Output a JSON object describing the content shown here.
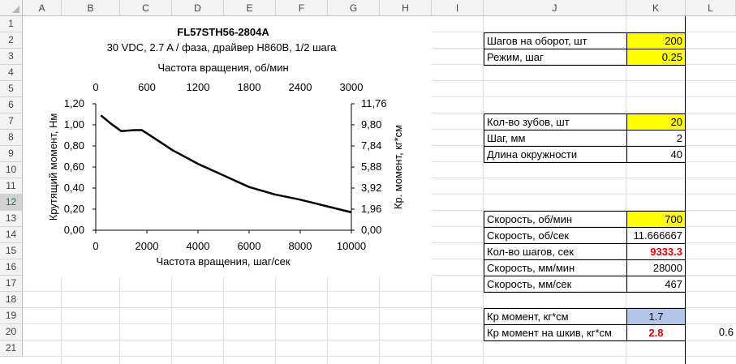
{
  "columns": [
    "A",
    "B",
    "C",
    "D",
    "E",
    "F",
    "G",
    "H",
    "I",
    "J",
    "K",
    "L"
  ],
  "rows": [
    "1",
    "2",
    "3",
    "4",
    "5",
    "6",
    "7",
    "8",
    "9",
    "10",
    "11",
    "12",
    "13",
    "14",
    "15",
    "16",
    "17",
    "18",
    "19",
    "20",
    "21"
  ],
  "selected_row": "12",
  "params": [
    {
      "row": 2,
      "label": "Шагов на оборот, шт",
      "value": "200",
      "fill": "yellow"
    },
    {
      "row": 3,
      "label": "Режим, шаг",
      "value": "0.25",
      "fill": "yellow"
    },
    {
      "row": 7,
      "label": "Кол-во зубов, шт",
      "value": "20",
      "fill": "yellow"
    },
    {
      "row": 8,
      "label": "Шаг, мм",
      "value": "2",
      "fill": ""
    },
    {
      "row": 9,
      "label": "Длина окружности",
      "value": "40",
      "fill": ""
    },
    {
      "row": 13,
      "label": "Скорость, об/мин",
      "value": "700",
      "fill": "yellow"
    },
    {
      "row": 14,
      "label": "Скорость, об/сек",
      "value": "11.666667",
      "fill": ""
    },
    {
      "row": 15,
      "label": "Кол-во шагов, сек",
      "value": "9333.3",
      "fill": "",
      "style": "red-right"
    },
    {
      "row": 16,
      "label": "Скорость, мм/мин",
      "value": "28000",
      "fill": ""
    },
    {
      "row": 17,
      "label": "Скорость, мм/сек",
      "value": "467",
      "fill": ""
    },
    {
      "row": 19,
      "label": "Кр момент, кг*см",
      "value": "1.7",
      "fill": "blue",
      "align": "center"
    },
    {
      "row": 20,
      "label": "Кр момент на шкив, кг*см",
      "value": "2.8",
      "fill": "",
      "style": "red-center"
    }
  ],
  "extra_cell": {
    "row": 20,
    "col": "L",
    "value": "0.6"
  },
  "colors": {
    "yellow": "#ffff00",
    "blue": "#b4c6e7",
    "red": "#e00000"
  },
  "chart_data": {
    "type": "line",
    "title": "FL57STH56-2804A",
    "subtitle": "30 VDC, 2.7 A / фаза, драйвер H860B, 1/2 шага",
    "xlabel": "Частота вращения, шаг/сек",
    "x2label": "Частота вращения, об/мин",
    "ylabel": "Крутящий момент, Нм",
    "y2label": "Кр. момент, кг*см",
    "xlim": [
      0,
      10000
    ],
    "ylim": [
      0,
      1.2
    ],
    "x_ticks": [
      "0",
      "2000",
      "4000",
      "6000",
      "8000",
      "10000"
    ],
    "x2_ticks": [
      "0",
      "600",
      "1200",
      "1800",
      "2400",
      "3000"
    ],
    "y_ticks": [
      "0,00",
      "0,20",
      "0,40",
      "0,60",
      "0,80",
      "1,00",
      "1,20"
    ],
    "y2_ticks": [
      "0,00",
      "1,96",
      "3,92",
      "5,88",
      "7,84",
      "9,80",
      "11,76"
    ],
    "series": [
      {
        "x": [
          200,
          600,
          1000,
          1500,
          1800,
          2000,
          2500,
          3000,
          4000,
          5000,
          6000,
          7000,
          8000,
          9000,
          10000
        ],
        "y": [
          1.09,
          1.01,
          0.94,
          0.95,
          0.95,
          0.92,
          0.84,
          0.76,
          0.63,
          0.52,
          0.41,
          0.34,
          0.29,
          0.23,
          0.17
        ]
      }
    ]
  }
}
